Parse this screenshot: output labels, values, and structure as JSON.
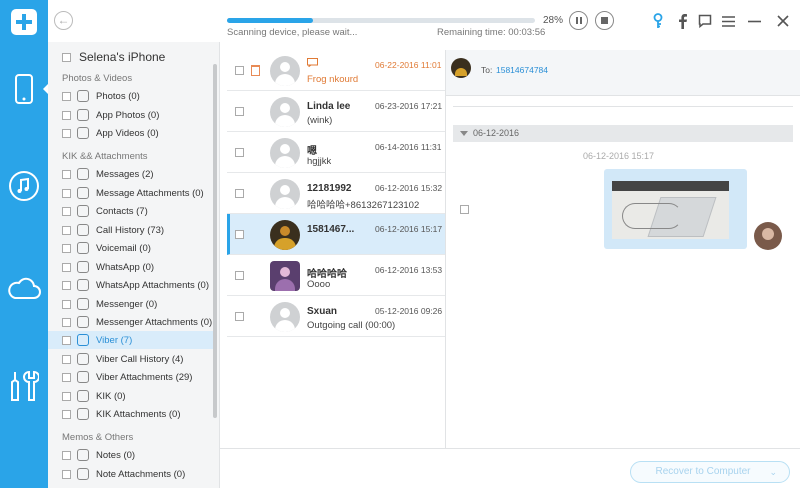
{
  "window": {
    "scan_status": "Scanning device, please wait...",
    "remaining_time": "Remaining time: 00:03:56",
    "progress_percent": 28,
    "progress_text": "28%"
  },
  "rail": {
    "items": [
      {
        "icon": "phone-icon",
        "active": true
      },
      {
        "icon": "music-icon",
        "active": false
      },
      {
        "icon": "cloud-icon",
        "active": false
      },
      {
        "icon": "tools-icon",
        "active": false
      }
    ]
  },
  "categories": {
    "device_name": "Selena's iPhone",
    "sections": [
      {
        "title": "Photos & Videos"
      },
      {
        "title": "KIK && Attachments"
      },
      {
        "title": "Memos & Others"
      }
    ],
    "items": [
      {
        "label": "Photos (0)",
        "icon": "photos-icon"
      },
      {
        "label": "App Photos (0)",
        "icon": "app-photos-icon"
      },
      {
        "label": "App Videos (0)",
        "icon": "app-videos-icon"
      },
      {
        "label": "Messages (2)",
        "icon": "messages-icon"
      },
      {
        "label": "Message Attachments (0)",
        "icon": "attachment-icon"
      },
      {
        "label": "Contacts (7)",
        "icon": "contacts-icon"
      },
      {
        "label": "Call History (73)",
        "icon": "phone-call-icon"
      },
      {
        "label": "Voicemail (0)",
        "icon": "voicemail-icon"
      },
      {
        "label": "WhatsApp (0)",
        "icon": "whatsapp-icon"
      },
      {
        "label": "WhatsApp Attachments (0)",
        "icon": "attachment-icon"
      },
      {
        "label": "Messenger (0)",
        "icon": "messenger-icon"
      },
      {
        "label": "Messenger Attachments (0)",
        "icon": "attachment-icon"
      },
      {
        "label": "Viber (7)",
        "icon": "viber-icon",
        "selected": true
      },
      {
        "label": "Viber Call History (4)",
        "icon": "viber-call-icon"
      },
      {
        "label": "Viber Attachments (29)",
        "icon": "attachment-icon"
      },
      {
        "label": "KIK (0)",
        "icon": "kik-icon"
      },
      {
        "label": "KIK Attachments (0)",
        "icon": "attachment-icon"
      },
      {
        "label": "Notes (0)",
        "icon": "notes-icon"
      },
      {
        "label": "Note Attachments (0)",
        "icon": "attachment-icon"
      }
    ]
  },
  "conversations": [
    {
      "name": "",
      "preview": "Frog nkourd",
      "time": "06-22-2016 11:01",
      "avatar": "default",
      "deleted": true
    },
    {
      "name": "Linda lee",
      "preview": "(wink)",
      "time": "06-23-2016 17:21",
      "avatar": "default"
    },
    {
      "name": "嗯",
      "preview": "hgjjkk",
      "time": "06-14-2016 11:31",
      "avatar": "default"
    },
    {
      "name": "12181992",
      "preview": "哈哈哈哈+8613267123102",
      "time": "06-12-2016 15:32",
      "avatar": "default"
    },
    {
      "name": "1581467...",
      "preview": "",
      "time": "06-12-2016 15:17",
      "avatar": "dark",
      "selected": true
    },
    {
      "name": "哈哈哈哈",
      "preview": "Oooo",
      "time": "06-12-2016 13:53",
      "avatar": "purple"
    },
    {
      "name": "Sxuan",
      "preview": "Outgoing call (00:00)",
      "time": "05-12-2016 09:26",
      "avatar": "default"
    }
  ],
  "detail": {
    "to_label": "To:",
    "to_number": "15814674784",
    "date_group": "06-12-2016",
    "timestamp": "06-12-2016 15:17"
  },
  "bottom": {
    "recover_label": "Recover to Computer"
  },
  "colors": {
    "accent": "#2aa4e8",
    "deleted": "#e07a35",
    "selected_bg": "#d9ecfa"
  }
}
